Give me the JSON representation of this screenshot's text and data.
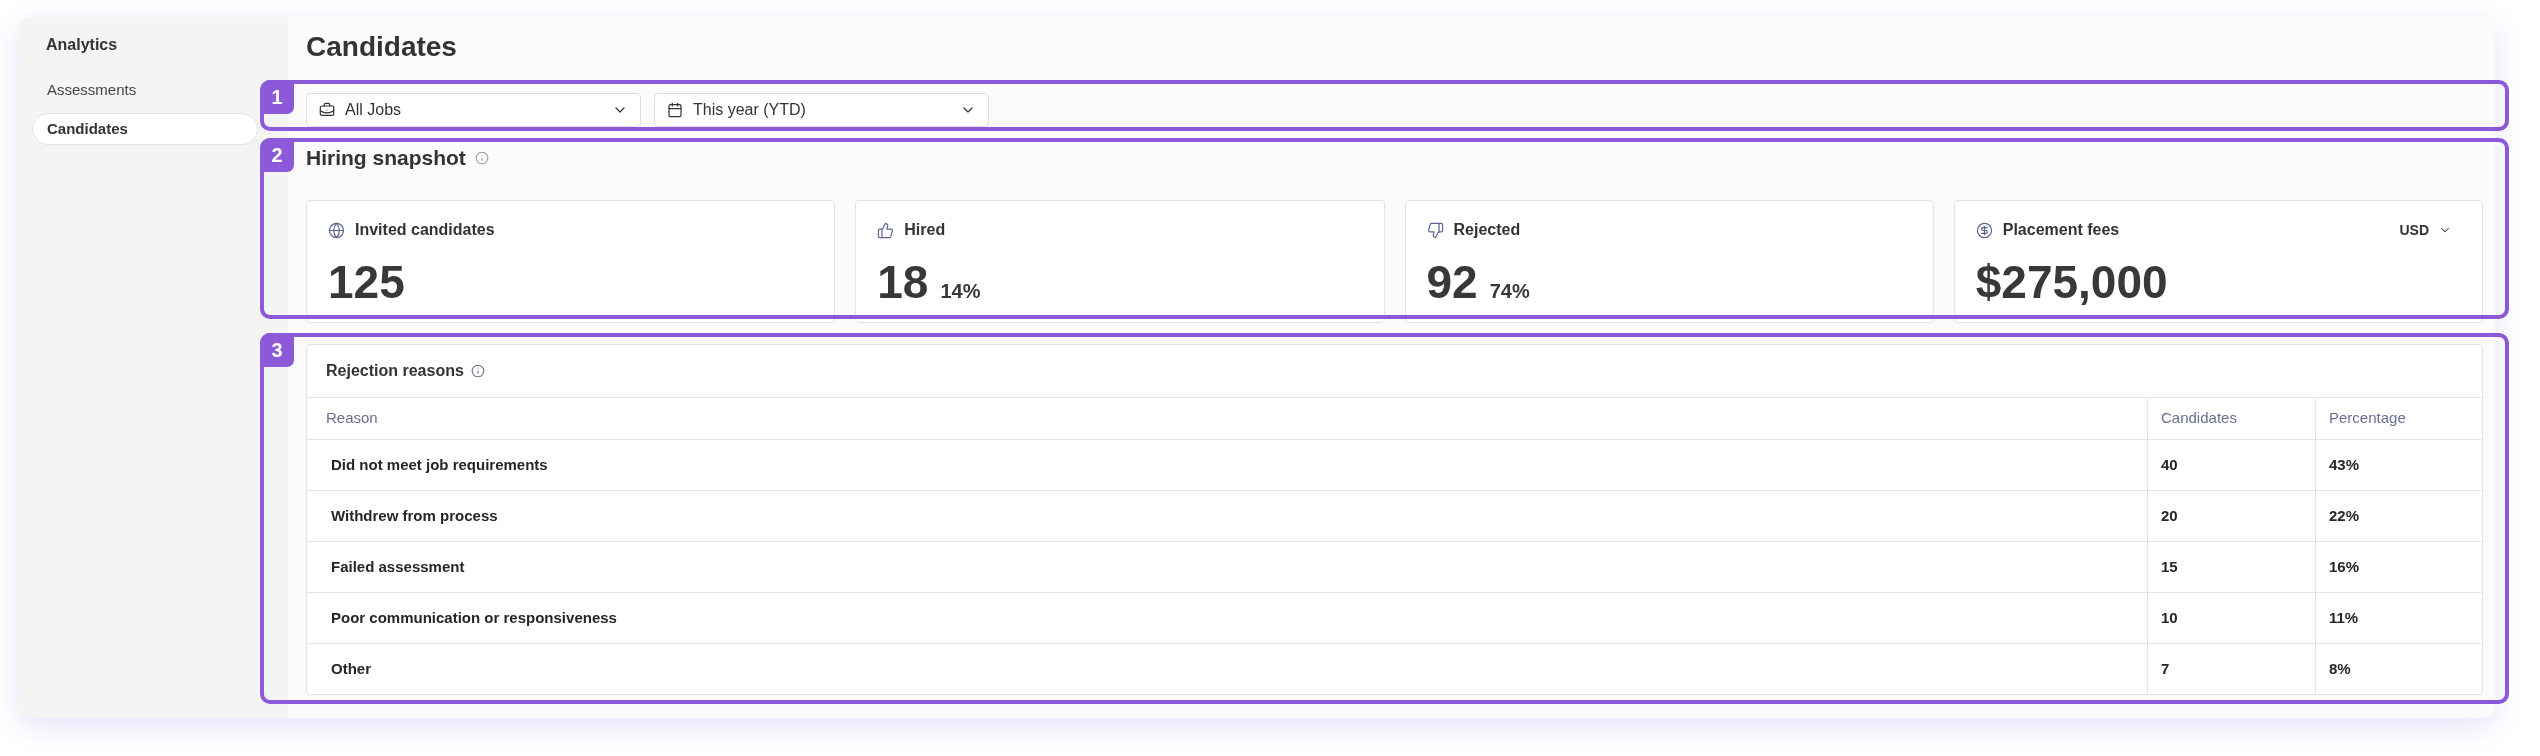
{
  "sidebar": {
    "title": "Analytics",
    "items": [
      {
        "label": "Assessments",
        "selected": false
      },
      {
        "label": "Candidates",
        "selected": true
      }
    ]
  },
  "page": {
    "title": "Candidates"
  },
  "filter_bar": {
    "annotation": "1",
    "dropdowns": [
      {
        "kind": "jobs",
        "value": "All Jobs"
      },
      {
        "kind": "date",
        "value": "This year (YTD)"
      }
    ]
  },
  "hiring_snapshot": {
    "annotation": "2",
    "title": "Hiring snapshot",
    "cards": [
      {
        "kind": "invited",
        "label": "Invited candidates",
        "value": "125"
      },
      {
        "kind": "hired",
        "label": "Hired",
        "value": "18",
        "percent": "14%"
      },
      {
        "kind": "rejected",
        "label": "Rejected",
        "value": "92",
        "percent": "74%"
      },
      {
        "kind": "fees",
        "label": "Placement fees",
        "value": "$275,000",
        "currency": "USD"
      }
    ]
  },
  "rejection_reasons": {
    "annotation": "3",
    "title": "Rejection reasons",
    "columns": [
      "Reason",
      "Candidates",
      "Percentage"
    ],
    "rows": [
      [
        "Did not meet job requirements",
        "40",
        "43%"
      ],
      [
        "Withdrew from process",
        "20",
        "22%"
      ],
      [
        "Failed assessment",
        "15",
        "16%"
      ],
      [
        "Poor communication or responsiveness",
        "10",
        "11%"
      ],
      [
        "Other",
        "7",
        "8%"
      ]
    ]
  }
}
